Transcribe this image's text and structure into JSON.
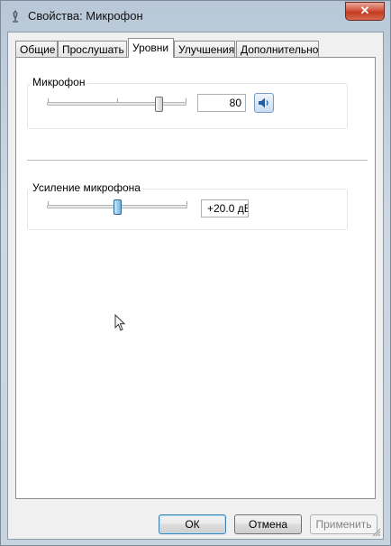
{
  "window": {
    "title": "Свойства: Микрофон",
    "close_label": "✕"
  },
  "tabs": [
    {
      "label": "Общие",
      "active": false
    },
    {
      "label": "Прослушать",
      "active": false
    },
    {
      "label": "Уровни",
      "active": true
    },
    {
      "label": "Улучшения",
      "active": false
    },
    {
      "label": "Дополнительно",
      "active": false
    }
  ],
  "levels": {
    "microphone": {
      "label": "Микрофон",
      "value": "80",
      "level_percent": 80,
      "mute_icon": "speaker-icon"
    },
    "boost": {
      "label": "Усиление микрофона",
      "value": "+20.0 дБ",
      "level_fraction": 0.5
    }
  },
  "buttons": {
    "ok": "ОК",
    "cancel": "Отмена",
    "apply": "Применить"
  },
  "colors": {
    "close_button": "#c13b20",
    "accent_blue": "#3c7fb1"
  }
}
